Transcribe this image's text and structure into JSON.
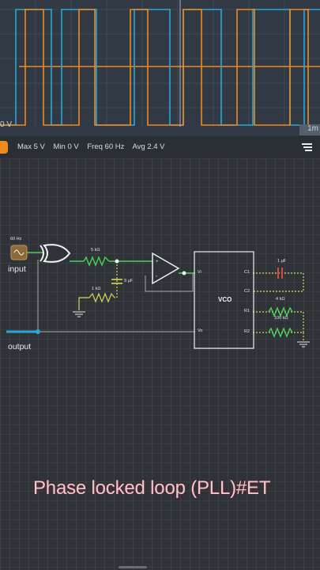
{
  "scope": {
    "zero_label": "0 V",
    "time_label": "1m",
    "colors": {
      "blue": "#2aa7d6",
      "orange": "#f08a1c"
    }
  },
  "status": {
    "max": "Max 5 V",
    "min": "Min 0 V",
    "freq": "Freq 60 Hz",
    "avg": "Avg 2.4 V",
    "menu_icon": "menu-icon"
  },
  "circuit": {
    "source_freq": "60 Hz",
    "input_label": "input",
    "output_label": "output",
    "r1": "5 kΩ",
    "r2": "1 kΩ",
    "c1": "9 μF",
    "vco_title": "VCO",
    "vco_pins": {
      "vi": "Vi",
      "vo": "Vo",
      "c1": "C1",
      "c2": "C2",
      "r1": "R1",
      "r2": "R2"
    },
    "c_ext": "1 μF",
    "r_ext1": "4 kΩ",
    "r_ext2": "100 kΩ"
  },
  "caption": "Phase locked loop (PLL)#ET"
}
